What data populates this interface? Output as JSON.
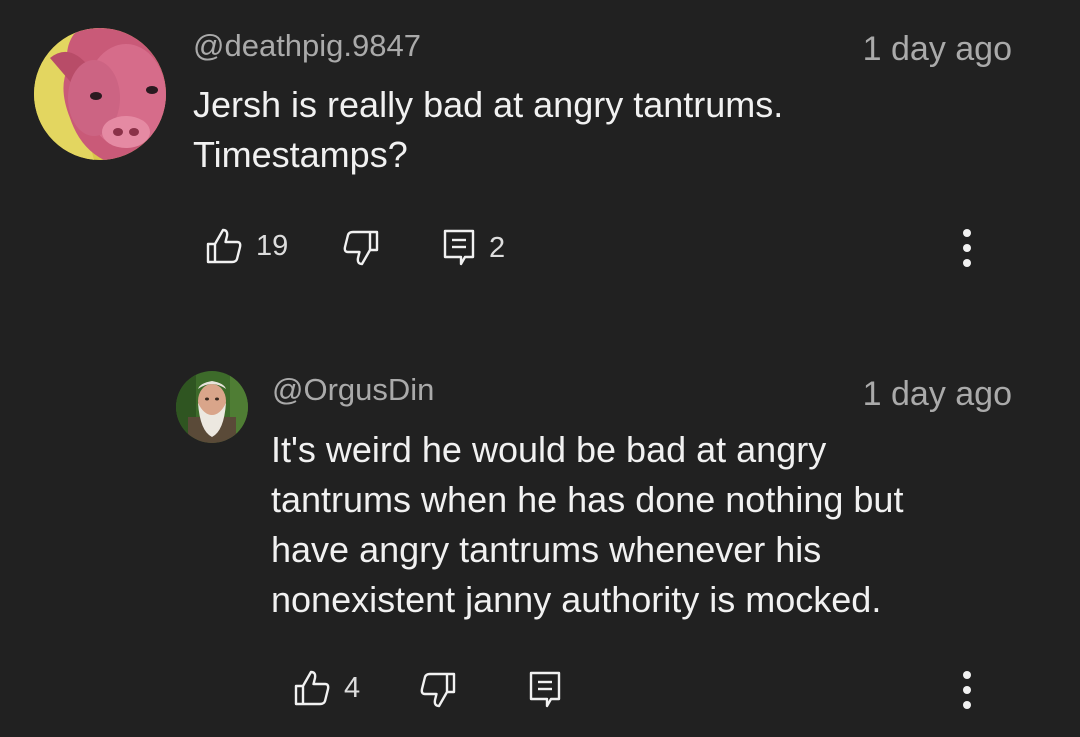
{
  "comments": [
    {
      "author": "@deathpig.9847",
      "time": "1 day ago",
      "text_lines": [
        "Jersh is really bad at angry tantrums.",
        "Timestamps?"
      ],
      "likes": "19",
      "replies": "2",
      "avatar_icon": "pink-pig-avatar"
    },
    {
      "author": "@OrgusDin",
      "time": "1 day ago",
      "text_lines": [
        "It's weird he would be bad at angry",
        "tantrums when he has done nothing but",
        "have angry tantrums whenever his",
        "nonexistent janny authority is mocked."
      ],
      "likes": "4",
      "replies": "",
      "avatar_icon": "bearded-man-avatar"
    }
  ],
  "icons": {
    "like": "thumbs-up-icon",
    "dislike": "thumbs-down-icon",
    "reply": "reply-icon",
    "more": "more-vertical-icon"
  },
  "colors": {
    "background": "#212121",
    "text": "#f1f1f1",
    "secondary": "#aaaaaa"
  }
}
